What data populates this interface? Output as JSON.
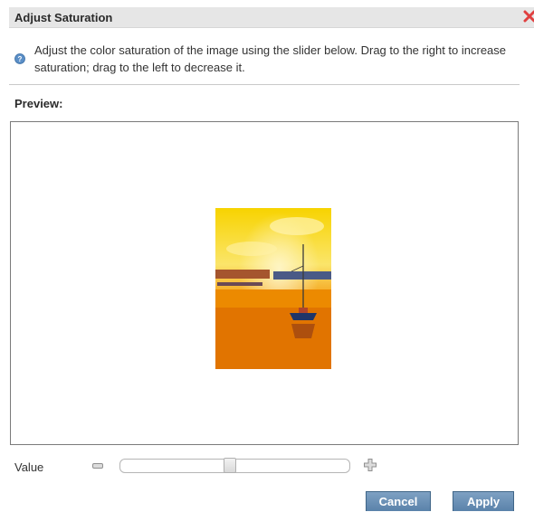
{
  "dialog": {
    "title": "Adjust Saturation",
    "info_text": "Adjust the color saturation of the image using the slider below. Drag to the right to increase saturation; drag to the left to decrease it.",
    "preview_label": "Preview:"
  },
  "slider": {
    "label": "Value",
    "value_fraction": 0.48
  },
  "buttons": {
    "cancel": "Cancel",
    "apply": "Apply"
  },
  "colors": {
    "close_icon": "#e04040",
    "button_bg": "#6a8fb5",
    "titlebar_bg": "#e6e6e6"
  }
}
